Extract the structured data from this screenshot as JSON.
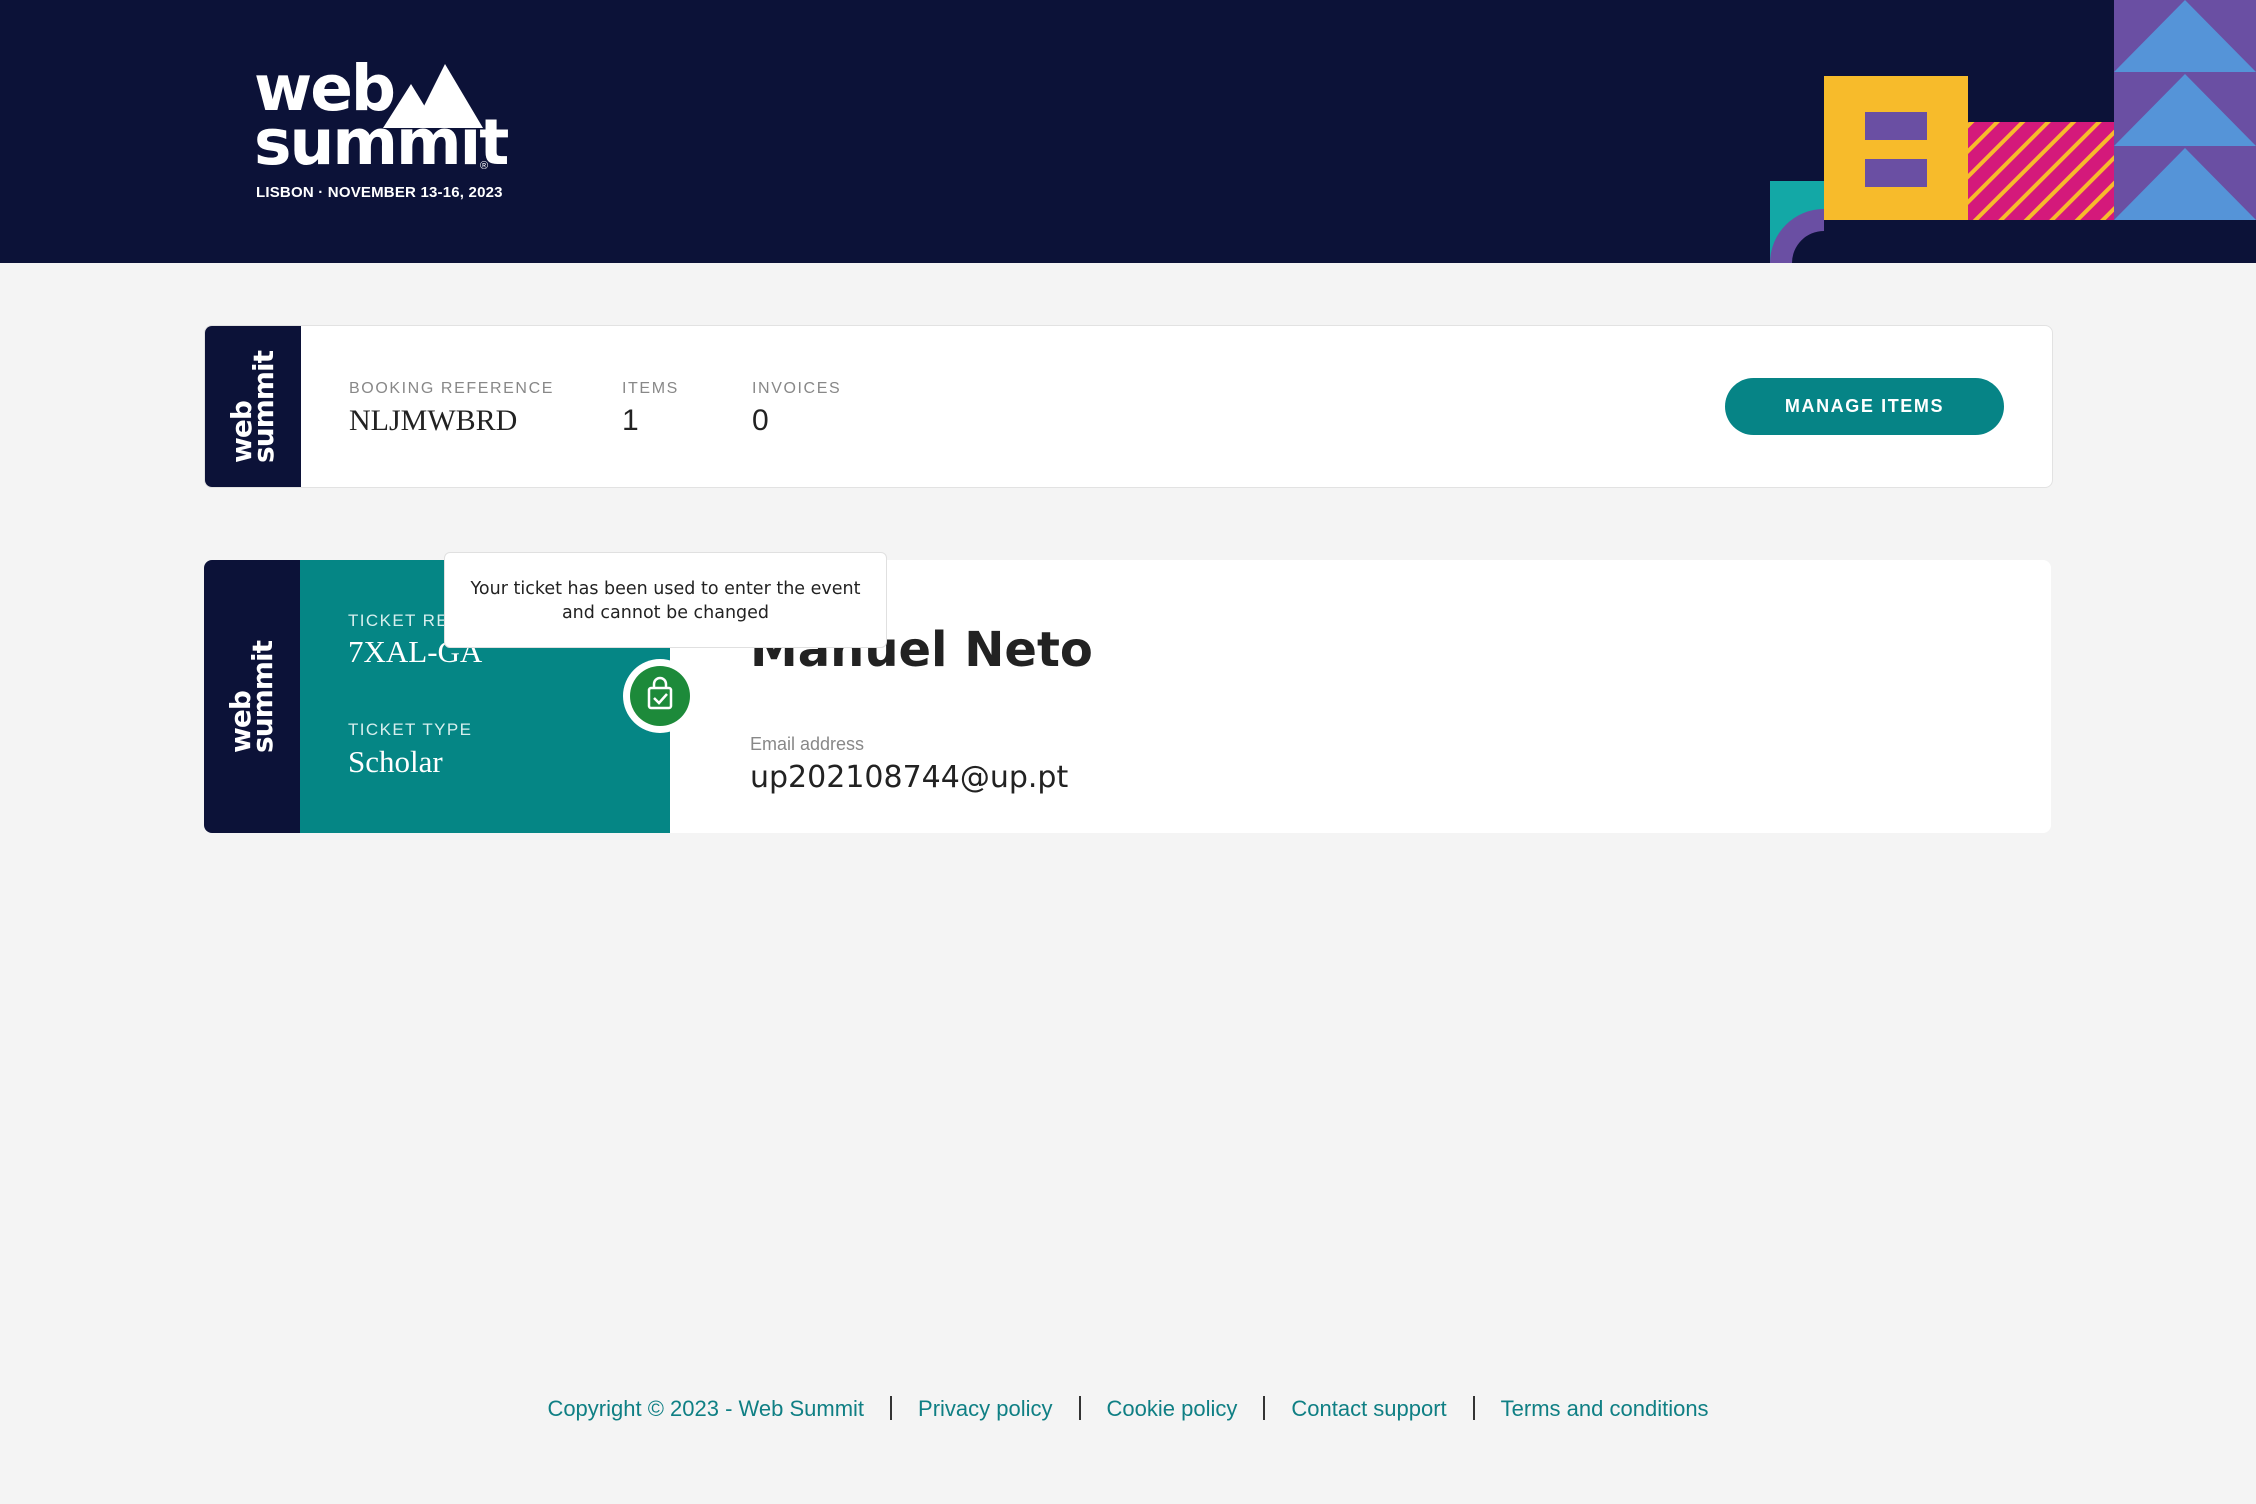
{
  "header": {
    "logo": {
      "word1": "web",
      "word2": "summit",
      "reg": "®",
      "event_line": "LISBON · NOVEMBER 13-16, 2023"
    },
    "colors": {
      "background": "#0c1238",
      "yellow": "#f7bb2b",
      "purple": "#6a4fa3",
      "pink": "#d4197b",
      "teal": "#13a8a6",
      "blue": "#5594d8"
    }
  },
  "booking": {
    "strip_logo": {
      "word1": "web",
      "word2": "summit"
    },
    "reference_label": "BOOKING REFERENCE",
    "reference_value": "NLJMWBRD",
    "items_label": "ITEMS",
    "items_value": "1",
    "invoices_label": "INVOICES",
    "invoices_value": "0",
    "manage_button": "MANAGE ITEMS"
  },
  "ticket": {
    "strip_logo": {
      "word1": "web",
      "word2": "summit"
    },
    "reference_label": "TICKET RE",
    "reference_value": "7XAL-GA",
    "type_label": "TICKET TYPE",
    "type_value": "Scholar",
    "status_icon": "ticket-check-icon",
    "tooltip": "Your ticket has been used to enter the event and cannot be changed",
    "attendee_name": "Manuel Neto",
    "email_label": "Email address",
    "email_value": "up202108744@up.pt"
  },
  "footer": {
    "links": [
      "Copyright © 2023 - Web Summit",
      "Privacy policy",
      "Cookie policy",
      "Contact support",
      "Terms and conditions"
    ]
  }
}
